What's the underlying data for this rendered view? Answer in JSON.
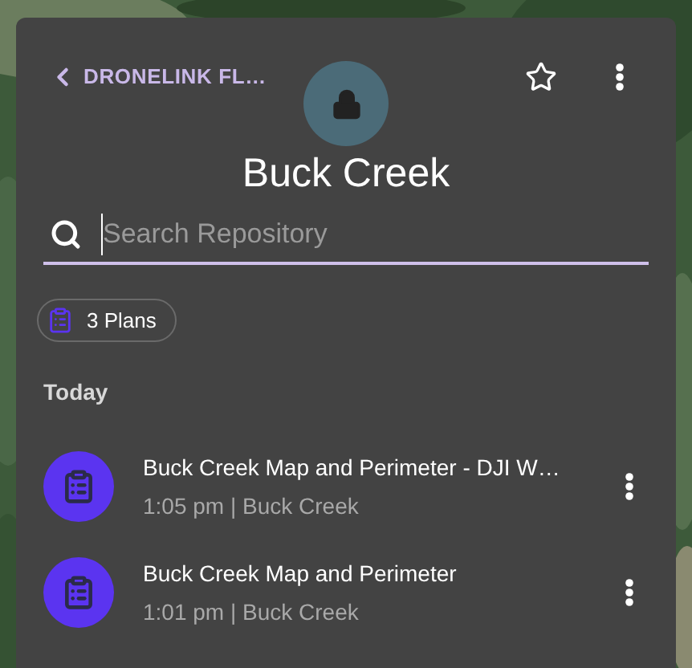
{
  "header": {
    "back_label": "DRONELINK FL…",
    "favorite": false
  },
  "title": "Buck Creek",
  "search": {
    "placeholder": "Search Repository"
  },
  "chip": {
    "label": "3 Plans"
  },
  "sections": [
    {
      "label": "Today",
      "plans": [
        {
          "title": "Buck Creek Map and Perimeter - DJI W…",
          "subtitle": "1:05 pm | Buck Creek"
        },
        {
          "title": "Buck Creek Map and Perimeter",
          "subtitle": "1:01 pm | Buck Creek"
        }
      ]
    }
  ]
}
